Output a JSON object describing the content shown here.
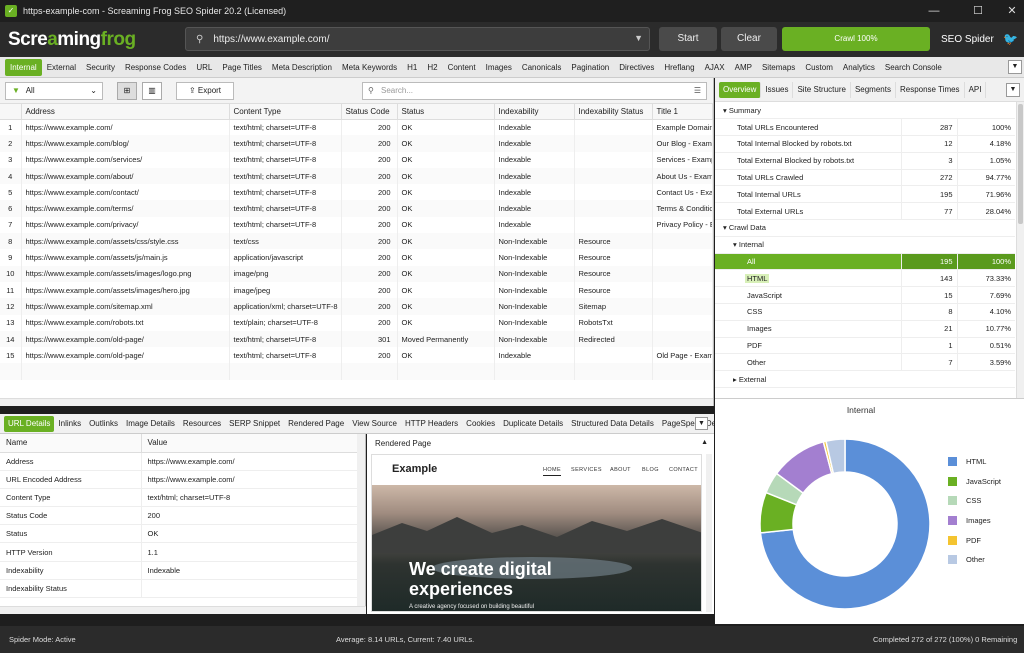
{
  "window": {
    "title": "https-example-com - Screaming Frog SEO Spider 20.2 (Licensed)"
  },
  "header": {
    "logo_a": "Scre",
    "logo_g": "a",
    "logo_b": "ming",
    "logo_c": "frog",
    "url": "https://www.example.com/",
    "start": "Start",
    "clear": "Clear",
    "crawl": "Crawl 100%",
    "product": "SEO Spider"
  },
  "main_tabs": [
    "Internal",
    "External",
    "Security",
    "Response Codes",
    "URL",
    "Page Titles",
    "Meta Description",
    "Meta Keywords",
    "H1",
    "H2",
    "Content",
    "Images",
    "Canonicals",
    "Pagination",
    "Directives",
    "Hreflang",
    "AJAX",
    "AMP",
    "Sitemaps",
    "Custom",
    "Analytics",
    "Search Console"
  ],
  "toolbar": {
    "filter": "All",
    "export": "Export",
    "search_placeholder": "Search..."
  },
  "url_table": {
    "columns": [
      "Address",
      "Content Type",
      "Status Code",
      "Status",
      "Indexability",
      "Indexability Status",
      "Title 1"
    ],
    "rows": [
      [
        "1",
        "https://www.example.com/",
        "text/html; charset=UTF-8",
        "200",
        "OK",
        "Indexable",
        "",
        "Example Domain"
      ],
      [
        "2",
        "https://www.example.com/blog/",
        "text/html; charset=UTF-8",
        "200",
        "OK",
        "Indexable",
        "",
        "Our Blog - Example"
      ],
      [
        "3",
        "https://www.example.com/services/",
        "text/html; charset=UTF-8",
        "200",
        "OK",
        "Indexable",
        "",
        "Services - Example"
      ],
      [
        "4",
        "https://www.example.com/about/",
        "text/html; charset=UTF-8",
        "200",
        "OK",
        "Indexable",
        "",
        "About Us - Example"
      ],
      [
        "5",
        "https://www.example.com/contact/",
        "text/html; charset=UTF-8",
        "200",
        "OK",
        "Indexable",
        "",
        "Contact Us - Example"
      ],
      [
        "6",
        "https://www.example.com/terms/",
        "text/html; charset=UTF-8",
        "200",
        "OK",
        "Indexable",
        "",
        "Terms & Conditions"
      ],
      [
        "7",
        "https://www.example.com/privacy/",
        "text/html; charset=UTF-8",
        "200",
        "OK",
        "Indexable",
        "",
        "Privacy Policy - Example"
      ],
      [
        "8",
        "https://www.example.com/assets/css/style.css",
        "text/css",
        "200",
        "OK",
        "Non-Indexable",
        "Resource",
        ""
      ],
      [
        "9",
        "https://www.example.com/assets/js/main.js",
        "application/javascript",
        "200",
        "OK",
        "Non-Indexable",
        "Resource",
        ""
      ],
      [
        "10",
        "https://www.example.com/assets/images/logo.png",
        "image/png",
        "200",
        "OK",
        "Non-Indexable",
        "Resource",
        ""
      ],
      [
        "11",
        "https://www.example.com/assets/images/hero.jpg",
        "image/jpeg",
        "200",
        "OK",
        "Non-Indexable",
        "Resource",
        ""
      ],
      [
        "12",
        "https://www.example.com/sitemap.xml",
        "application/xml; charset=UTF-8",
        "200",
        "OK",
        "Non-Indexable",
        "Sitemap",
        ""
      ],
      [
        "13",
        "https://www.example.com/robots.txt",
        "text/plain; charset=UTF-8",
        "200",
        "OK",
        "Non-Indexable",
        "RobotsTxt",
        ""
      ],
      [
        "14",
        "https://www.example.com/old-page/",
        "text/html; charset=UTF-8",
        "301",
        "Moved Permanently",
        "Non-Indexable",
        "Redirected",
        ""
      ],
      [
        "15",
        "https://www.example.com/old-page/",
        "text/html; charset=UTF-8",
        "200",
        "OK",
        "Indexable",
        "",
        "Old Page - Example"
      ]
    ]
  },
  "right_tabs": [
    "Overview",
    "Issues",
    "Site Structure",
    "Segments",
    "Response Times",
    "API"
  ],
  "overview": {
    "summary": "Summary",
    "summary_rows": [
      [
        "Total URLs Encountered",
        "287",
        "100%"
      ],
      [
        "Total Internal Blocked by robots.txt",
        "12",
        "4.18%"
      ],
      [
        "Total External Blocked by robots.txt",
        "3",
        "1.05%"
      ],
      [
        "Total URLs Crawled",
        "272",
        "94.77%"
      ],
      [
        "Total Internal URLs",
        "195",
        "71.96%"
      ],
      [
        "Total External URLs",
        "77",
        "28.04%"
      ]
    ],
    "crawl_data": "Crawl Data",
    "internal": "Internal",
    "internal_rows": [
      [
        "All",
        "195",
        "100%"
      ],
      [
        "HTML",
        "143",
        "73.33%"
      ],
      [
        "JavaScript",
        "15",
        "7.69%"
      ],
      [
        "CSS",
        "8",
        "4.10%"
      ],
      [
        "Images",
        "21",
        "10.77%"
      ],
      [
        "PDF",
        "1",
        "0.51%"
      ],
      [
        "Other",
        "7",
        "3.59%"
      ]
    ],
    "external": "External"
  },
  "bottom_tabs": [
    "URL Details",
    "Inlinks",
    "Outlinks",
    "Image Details",
    "Resources",
    "SERP Snippet",
    "Rendered Page",
    "View Source",
    "HTTP Headers",
    "Cookies",
    "Duplicate Details",
    "Structured Data Details",
    "PageSpeed Details"
  ],
  "details": {
    "col_name": "Name",
    "col_value": "Value",
    "rows": [
      [
        "Address",
        "https://www.example.com/"
      ],
      [
        "URL Encoded Address",
        "https://www.example.com/"
      ],
      [
        "Content Type",
        "text/html; charset=UTF-8"
      ],
      [
        "Status Code",
        "200"
      ],
      [
        "Status",
        "OK"
      ],
      [
        "HTTP Version",
        "1.1"
      ],
      [
        "Indexability",
        "Indexable"
      ],
      [
        "Indexability Status",
        ""
      ]
    ]
  },
  "rendered": {
    "label": "Rendered Page",
    "brand": "Example",
    "nav": [
      "HOME",
      "SERVICES",
      "ABOUT",
      "BLOG",
      "CONTACT"
    ],
    "headline_1": "We create digital",
    "headline_2": "experiences",
    "sub": "A creative agency focused on building beautiful"
  },
  "chart_data": {
    "type": "pie",
    "title": "Internal",
    "categories": [
      "HTML",
      "JavaScript",
      "CSS",
      "Images",
      "PDF",
      "Other"
    ],
    "values": [
      143,
      15,
      8,
      21,
      1,
      7
    ],
    "colors": [
      "#5b8fd8",
      "#6ab023",
      "#b6d9b8",
      "#a37fd0",
      "#f4c430",
      "#b8c9e3"
    ],
    "legend": "right"
  },
  "status": {
    "left": "Spider Mode: Active",
    "mid": "Average: 8.14 URLs, Current: 7.40 URLs.",
    "right": "Completed 272 of 272 (100%) 0 Remaining"
  }
}
